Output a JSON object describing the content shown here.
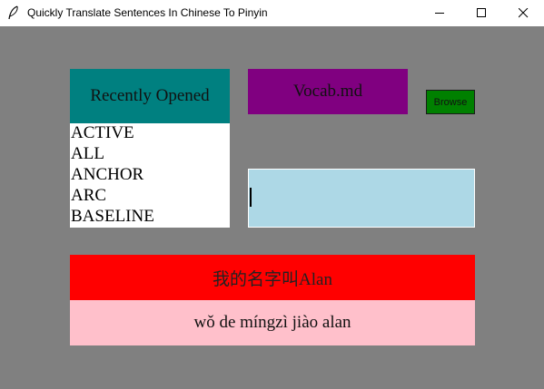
{
  "window": {
    "title": "Quickly Translate Sentences In Chinese To Pinyin",
    "app_icon": "feather-icon",
    "controls": {
      "minimize": "minimize-icon",
      "maximize": "maximize-icon",
      "close": "close-icon"
    }
  },
  "colors": {
    "background": "#808080",
    "recent_header": "#008080",
    "vocab_label": "#800080",
    "browse_button": "#008000",
    "text_input": "#add8e6",
    "chinese_output": "#ff0000",
    "pinyin_output": "#ffc0cb"
  },
  "recent": {
    "header": "Recently Opened",
    "items": [
      "ACTIVE",
      "ALL",
      "ANCHOR",
      "ARC",
      "BASELINE"
    ]
  },
  "vocab": {
    "file_label": "Vocab.md",
    "browse_label": "Browse"
  },
  "input": {
    "value": ""
  },
  "output": {
    "chinese": "我的名字叫Alan",
    "pinyin": "wǒ de míngzì jiào alan"
  }
}
